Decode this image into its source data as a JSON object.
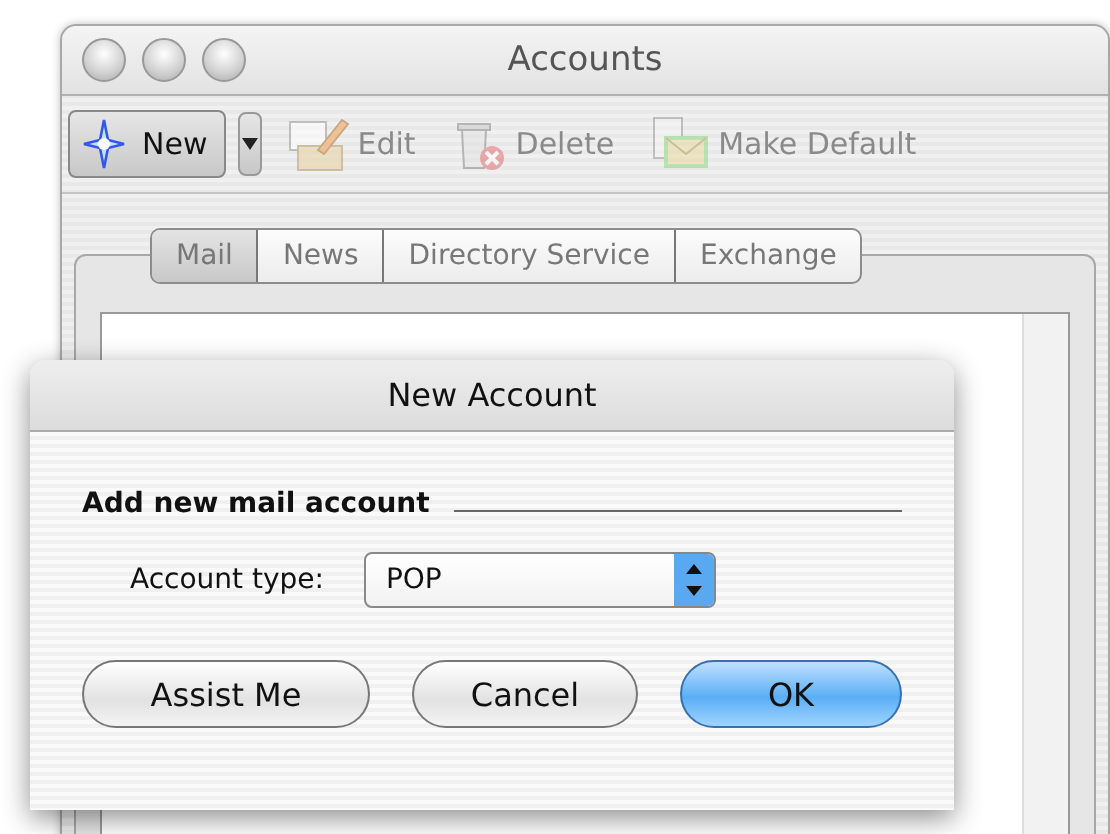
{
  "window": {
    "title": "Accounts"
  },
  "toolbar": [
    {
      "kind": "new",
      "label": "New",
      "disabled": false
    },
    {
      "kind": "edit",
      "label": "Edit",
      "disabled": true
    },
    {
      "kind": "delete",
      "label": "Delete",
      "disabled": true
    },
    {
      "kind": "make_default",
      "label": "Make Default",
      "disabled": true
    }
  ],
  "tabs": [
    {
      "label": "Mail",
      "selected": true
    },
    {
      "label": "News",
      "selected": false
    },
    {
      "label": "Directory Service",
      "selected": false
    },
    {
      "label": "Exchange",
      "selected": false
    }
  ],
  "dialog": {
    "title": "New Account",
    "section_title": "Add new mail account",
    "field_label": "Account type:",
    "account_type": "POP",
    "buttons": [
      {
        "label": "Assist Me",
        "default": false
      },
      {
        "label": "Cancel",
        "default": false
      },
      {
        "label": "OK",
        "default": true
      }
    ]
  }
}
